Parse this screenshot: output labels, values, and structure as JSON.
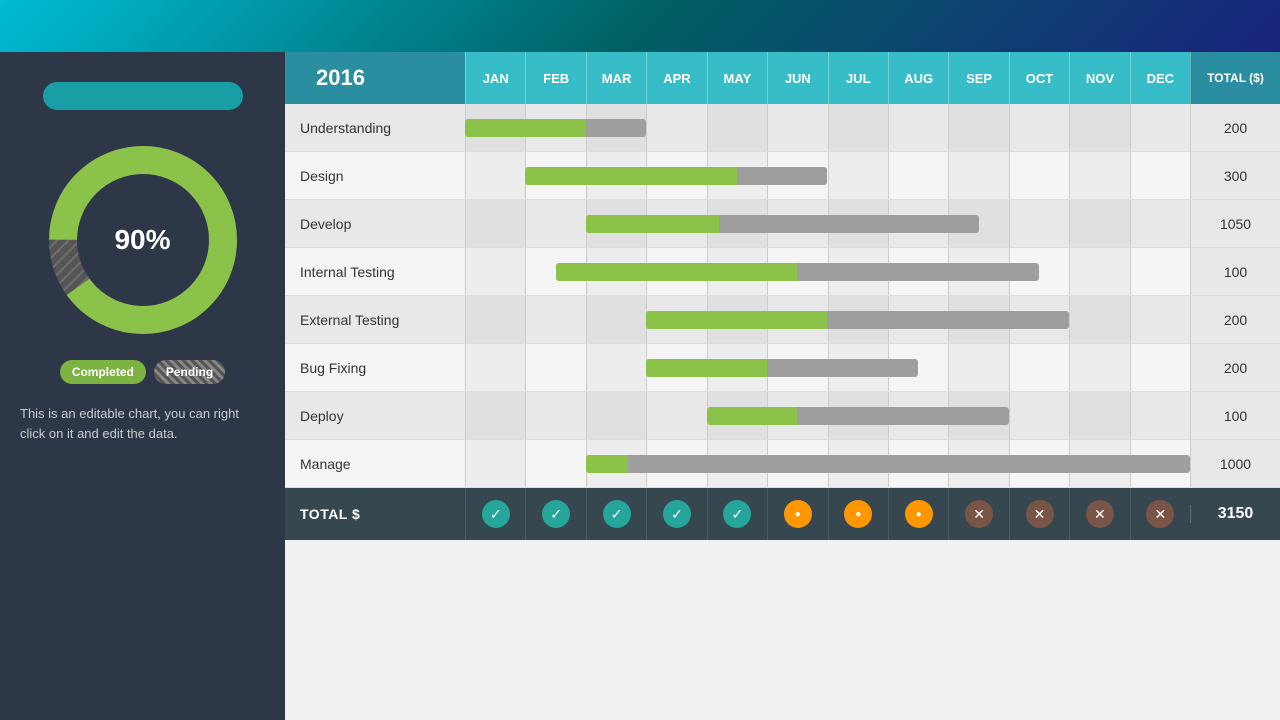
{
  "topBar": {},
  "leftPanel": {
    "progressBarLabel": "",
    "percentLabel": "90%",
    "legend": {
      "completed": "Completed",
      "pending": "Pending"
    },
    "infoText": "This is an editable chart, you can right click on it and edit the data."
  },
  "chart": {
    "year": "2016",
    "totalHeader": "TOTAL ($)",
    "months": [
      "JAN",
      "FEB",
      "MAR",
      "APR",
      "MAY",
      "JUN",
      "JUL",
      "AUG",
      "SEP",
      "OCT",
      "NOV",
      "DEC"
    ],
    "rows": [
      {
        "label": "Understanding",
        "greenStart": 0,
        "greenEnd": 2,
        "grayStart": 2,
        "grayEnd": 3,
        "total": "200"
      },
      {
        "label": "Design",
        "greenStart": 1,
        "greenEnd": 4.5,
        "grayStart": 4.5,
        "grayEnd": 6,
        "total": "300"
      },
      {
        "label": "Develop",
        "greenStart": 2,
        "greenEnd": 4.2,
        "grayStart": 4.2,
        "grayEnd": 8.5,
        "total": "1050"
      },
      {
        "label": "Internal Testing",
        "greenStart": 1.5,
        "greenEnd": 5.5,
        "grayStart": 5.5,
        "grayEnd": 9.5,
        "total": "100"
      },
      {
        "label": "External Testing",
        "greenStart": 3,
        "greenEnd": 6,
        "grayStart": 6,
        "grayEnd": 10,
        "total": "200"
      },
      {
        "label": "Bug Fixing",
        "greenStart": 3,
        "greenEnd": 5,
        "grayStart": 5,
        "grayEnd": 7.5,
        "total": "200"
      },
      {
        "label": "Deploy",
        "greenStart": 4,
        "greenEnd": 5.5,
        "grayStart": 5.5,
        "grayEnd": 9,
        "total": "100"
      },
      {
        "label": "Manage",
        "greenStart": 2,
        "greenEnd": 2.7,
        "grayStart": 2.7,
        "grayEnd": 12,
        "total": "1000"
      }
    ],
    "totalRow": {
      "label": "TOTAL $",
      "icons": [
        "check",
        "check",
        "check",
        "check",
        "check",
        "circle",
        "circle",
        "circle",
        "x",
        "x",
        "x",
        "x"
      ],
      "total": "3150"
    }
  }
}
